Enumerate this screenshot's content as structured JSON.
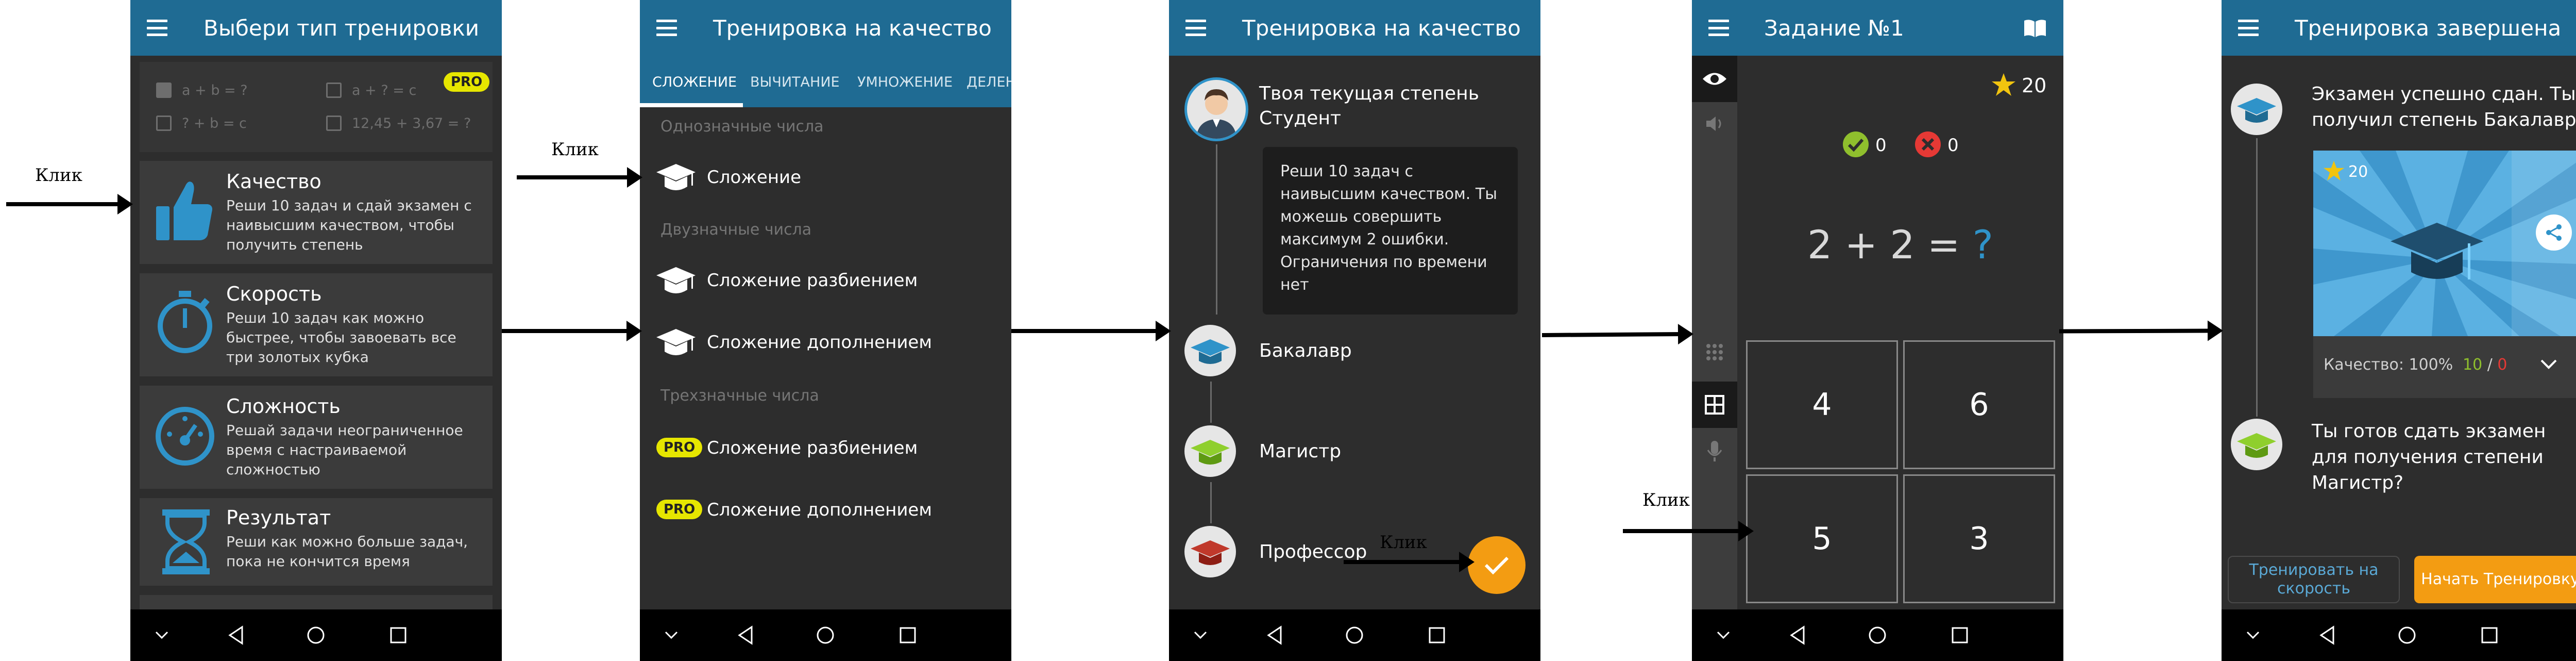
{
  "annotations": {
    "click_label": "Клик"
  },
  "screen1": {
    "title": "Выбери тип тренировки",
    "formulas": [
      "a + b = ?",
      "a + ? = c",
      "? + b = c",
      "12,45 + 3,67 = ?"
    ],
    "pro_badge": "PRO",
    "tiles": [
      {
        "title": "Качество",
        "desc": "Реши 10 задач и сдай экзамен с наивысшим качеством, чтобы получить степень",
        "icon": "thumbs-up-icon"
      },
      {
        "title": "Скорость",
        "desc": "Реши 10 задач как можно быстрее, чтобы завоевать все три золотых кубка",
        "icon": "stopwatch-icon"
      },
      {
        "title": "Сложность",
        "desc": "Решай задачи неограниченное время с настраиваемой сложностью",
        "icon": "speedometer-icon"
      },
      {
        "title": "Результат",
        "desc": "Реши как можно больше задач, пока не кончится время",
        "icon": "hourglass-icon"
      }
    ]
  },
  "screen2": {
    "title": "Тренировка на качество",
    "tabs": [
      "СЛОЖЕНИЕ",
      "ВЫЧИТАНИЕ",
      "УМНОЖЕНИЕ",
      "ДЕЛЕНИЕ"
    ],
    "sections": [
      "Однозначные числа",
      "Двузначные числа",
      "Трехзначные числа"
    ],
    "items": [
      "Сложение",
      "Сложение разбиением",
      "Сложение дополнением",
      "Сложение разбиением",
      "Сложение дополнением"
    ],
    "pro_badge": "PRO"
  },
  "screen3": {
    "title": "Тренировка на качество",
    "current_degree": "Твоя текущая степень Студент",
    "bubble": "Реши 10 задач с наивысшим качеством. Ты можешь совершить максимум 2 ошибки. Ограничения по времени нет",
    "levels": [
      "Бакалавр",
      "Магистр",
      "Профессор"
    ]
  },
  "screen4": {
    "title": "Задание №1",
    "stars": "20",
    "correct": "0",
    "wrong": "0",
    "expression": "2 + 2 = ",
    "unknown": "?",
    "answers": [
      "4",
      "6",
      "5",
      "3"
    ]
  },
  "screen5": {
    "title": "Тренировка завершена",
    "message1": "Экзамен успешно сдан. Ты получил степень Бакалавр",
    "card_stars": "20",
    "quality_label": "Качество: 100%",
    "score_correct": "10",
    "score_sep": " / ",
    "score_wrong": "0",
    "message2": "Ты готов сдать экзамен для получения степени Магистр?",
    "btn_speed": "Тренировать на скорость",
    "btn_start": "Начать Тренировку"
  },
  "colors": {
    "appbar": "#1f6b93",
    "background": "#2d2d2d",
    "accent": "#f39c12",
    "pro": "#e6e600"
  }
}
